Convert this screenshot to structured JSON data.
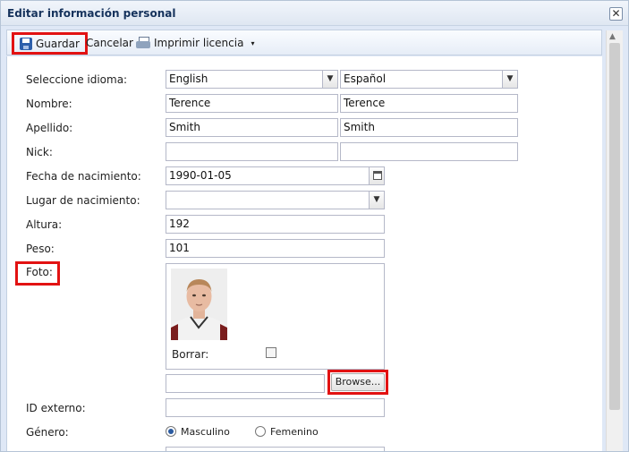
{
  "window": {
    "title": "Editar información personal",
    "close_glyph": "✕"
  },
  "toolbar": {
    "save_label": "Guardar",
    "cancel_label": "Cancelar",
    "print_label": "Imprimir licencia",
    "caret": "▾"
  },
  "form": {
    "language": {
      "label": "Seleccione idioma:",
      "value1": "English",
      "value2": "Español"
    },
    "name": {
      "label": "Nombre:",
      "value1": "Terence",
      "value2": "Terence"
    },
    "surname": {
      "label": "Apellido:",
      "value1": "Smith",
      "value2": "Smith"
    },
    "nick": {
      "label": "Nick:",
      "value1": "",
      "value2": ""
    },
    "birth_date": {
      "label": "Fecha de nacimiento:",
      "value": "1990-01-05"
    },
    "birth_place": {
      "label": "Lugar de nacimiento:",
      "value": ""
    },
    "height": {
      "label": "Altura:",
      "value": "192"
    },
    "weight": {
      "label": "Peso:",
      "value": "101"
    },
    "photo": {
      "label": "Foto:",
      "delete_label": "Borrar:",
      "browse_label": "Browse..."
    },
    "external_id": {
      "label": "ID externo:",
      "value": ""
    },
    "gender": {
      "label": "Género:",
      "option_male": "Masculino",
      "option_female": "Femenino"
    }
  },
  "icons": {
    "dropdown": "▼",
    "scroll_up": "▲"
  },
  "colors": {
    "highlight": "#e21212",
    "title_text": "#15325c"
  }
}
